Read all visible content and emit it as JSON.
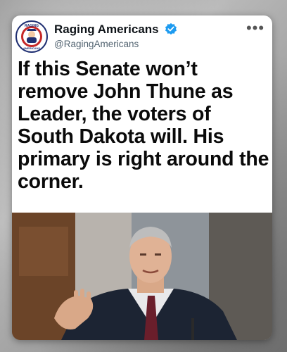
{
  "account": {
    "display_name": "Raging Americans",
    "handle": "@RagingAmericans",
    "verified": true,
    "avatar_text_top": "RAGING",
    "avatar_text_bottom": "AMERICANS"
  },
  "tweet": {
    "text": "If this Senate won’t remove John Thune as Leader, the voters of South Dakota will. His primary is right around the corner."
  },
  "menu": {
    "more_icon": "more-horizontal-icon"
  },
  "colors": {
    "verified_badge": "#1d9bf0",
    "text": "#0f1419",
    "handle": "#536471",
    "avatar_ring": "#1f2f72"
  },
  "media": {
    "photo_icon": "photo-man-gesturing"
  }
}
